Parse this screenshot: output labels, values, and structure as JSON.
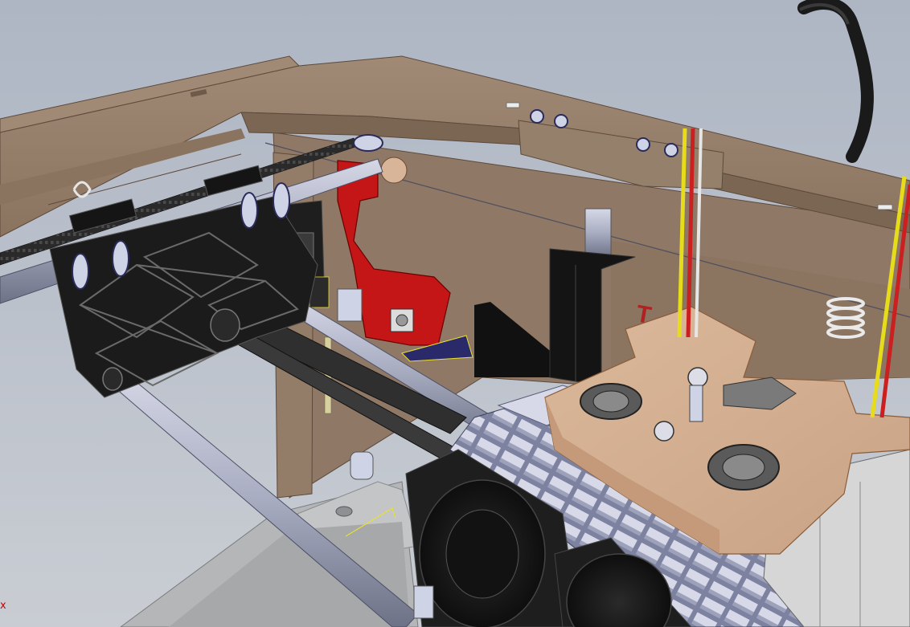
{
  "viewport": {
    "background_top": "#aeb6c4",
    "background_bottom": "#c9cdd3",
    "axis_indicator_label": "x"
  },
  "colors": {
    "frame_wood": "#8f7966",
    "frame_wood_light": "#a08a76",
    "frame_wood_dark": "#6e5a49",
    "carriage_tan": "#d2ad90",
    "bracket_red": "#c41616",
    "parts_black": "#1b1b1b",
    "rod_steel": "#a9adc2",
    "bed_gray": "#b4b6b7",
    "wire_yellow": "#e6dc1a",
    "wire_red": "#cc1f1f",
    "selection_yellow": "#e8e030",
    "axis_red": "#cc0000"
  },
  "scene_parts": [
    {
      "name": "wooden-frame-top",
      "icon": "frame-panel-icon"
    },
    {
      "name": "x-carriage-black",
      "icon": "carriage-icon"
    },
    {
      "name": "red-endstop-bracket",
      "icon": "bracket-icon"
    },
    {
      "name": "extruder-carriage-tan",
      "icon": "extruder-icon"
    },
    {
      "name": "cooling-fans",
      "icon": "fan-icon"
    },
    {
      "name": "cable-chain",
      "icon": "chain-icon"
    },
    {
      "name": "print-bed",
      "icon": "bed-icon"
    },
    {
      "name": "filament-tube",
      "icon": "tube-icon"
    }
  ]
}
